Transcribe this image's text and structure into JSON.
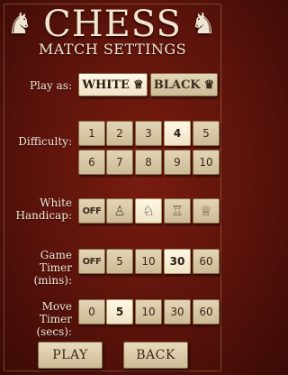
{
  "header": {
    "title": "CHESS",
    "subtitle": "MATCH SETTINGS"
  },
  "play_as": {
    "label": "Play as:",
    "options": [
      {
        "label": "WHITE",
        "icon": "white-queen-icon",
        "glyph": "♕",
        "selected": true
      },
      {
        "label": "BLACK",
        "icon": "black-queen-icon",
        "glyph": "♛",
        "selected": false
      }
    ]
  },
  "difficulty": {
    "label": "Difficulty:",
    "options": [
      "1",
      "2",
      "3",
      "4",
      "5",
      "6",
      "7",
      "8",
      "9",
      "10"
    ],
    "selected": "4"
  },
  "handicap": {
    "label_line1": "White",
    "label_line2": "Handicap:",
    "options": [
      {
        "label": "OFF",
        "icon": null,
        "glyph": ""
      },
      {
        "label": "",
        "icon": "pawn-icon",
        "glyph": "♙"
      },
      {
        "label": "",
        "icon": "knight-icon",
        "glyph": "♘"
      },
      {
        "label": "",
        "icon": "rook-icon",
        "glyph": "♖"
      },
      {
        "label": "",
        "icon": "queen-icon",
        "glyph": "♕"
      }
    ],
    "selected_index": 2
  },
  "game_timer": {
    "label_line1": "Game Timer",
    "label_line2": "(mins):",
    "options": [
      "OFF",
      "5",
      "10",
      "30",
      "60"
    ],
    "selected": "30"
  },
  "move_timer": {
    "label_line1": "Move Timer",
    "label_line2": "(secs):",
    "options": [
      "0",
      "5",
      "10",
      "30",
      "60"
    ],
    "selected": "5"
  },
  "footer": {
    "play_label": "PLAY",
    "back_label": "BACK"
  }
}
